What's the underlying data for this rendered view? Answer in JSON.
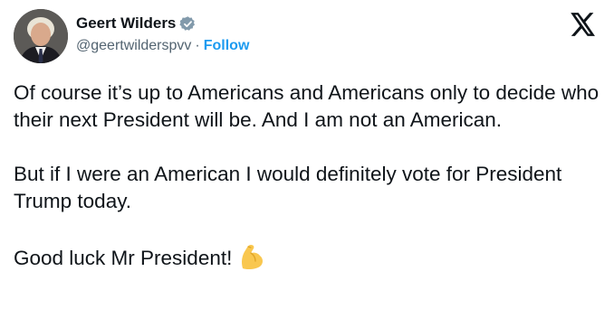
{
  "tweet": {
    "author": {
      "display_name": "Geert Wilders",
      "handle": "@geertwilderspvv",
      "separator": "·",
      "follow_label": "Follow",
      "verified_icon": "verified-badge-icon",
      "avatar": "avatar"
    },
    "platform_icon": "x-logo-icon",
    "paragraphs": [
      "Of course it’s up to Americans and Americans only to decide who their next President will be. And I am not an American.",
      "But if I were an American I would definitely vote for President Trump today.",
      "Good luck Mr President!"
    ],
    "emoji": "flexed-biceps-emoji",
    "colors": {
      "text": "#0f1419",
      "secondary": "#536471",
      "accent": "#1d9bf0"
    }
  }
}
